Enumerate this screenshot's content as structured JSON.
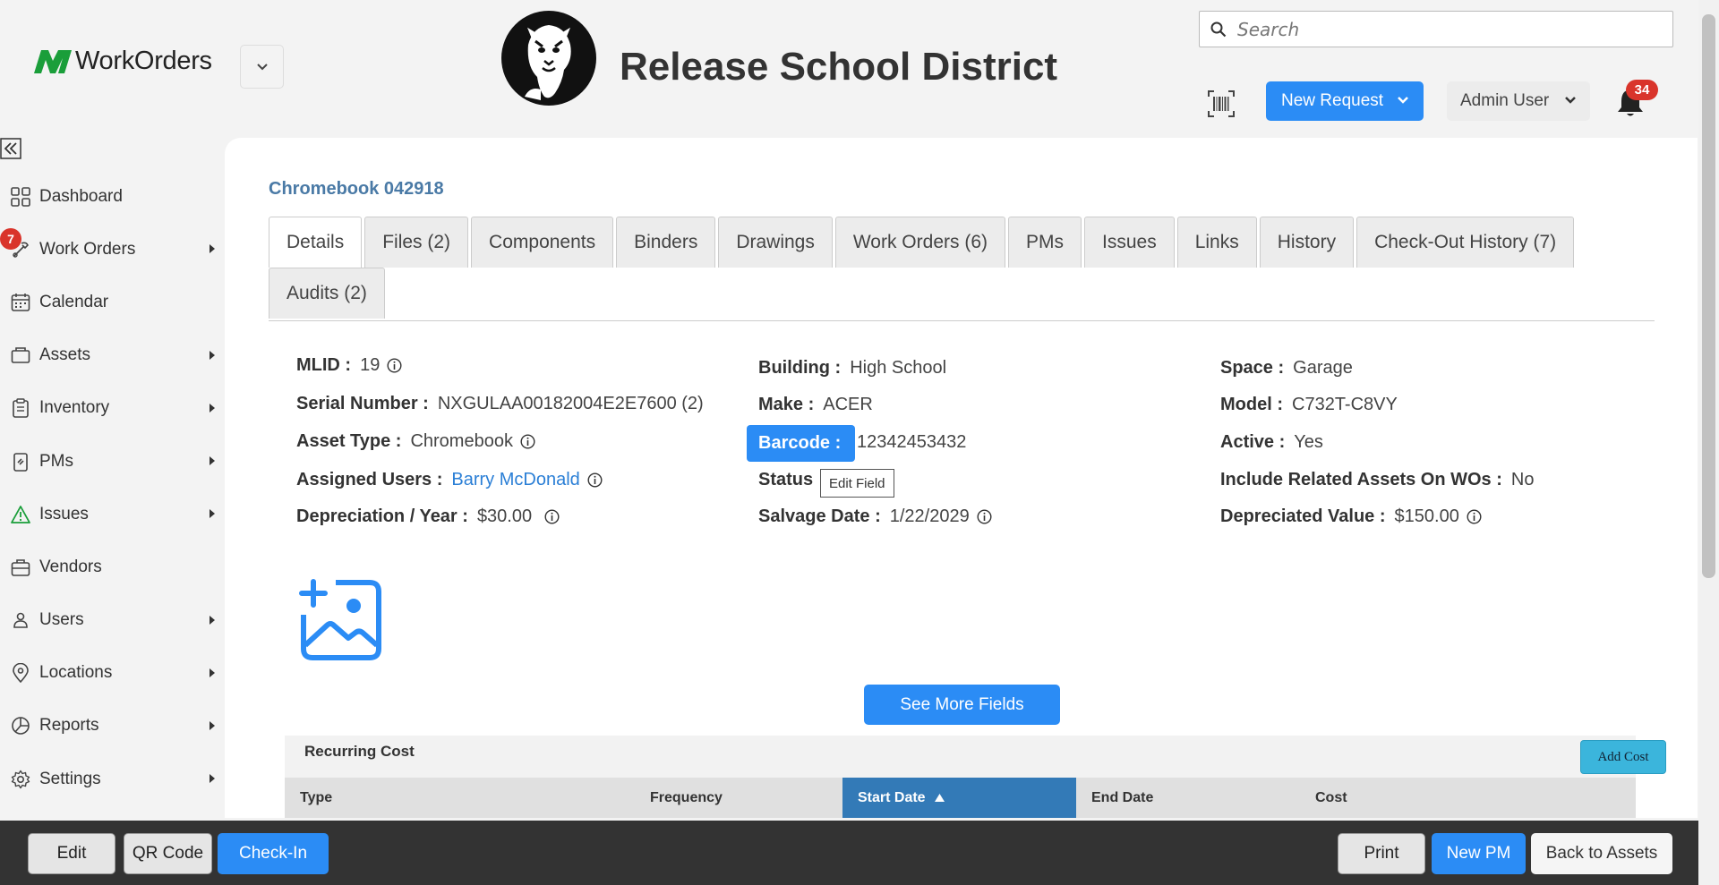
{
  "header": {
    "app_name": "WorkOrders",
    "district_name": "Release School District",
    "search_placeholder": "Search",
    "new_request_label": "New Request",
    "user_label": "Admin User",
    "notification_count": "34"
  },
  "sidebar": {
    "items": [
      {
        "label": "Dashboard",
        "icon": "dashboard-icon",
        "has_submenu": false
      },
      {
        "label": "Work Orders",
        "icon": "work-orders-icon",
        "has_submenu": true,
        "badge": "7"
      },
      {
        "label": "Calendar",
        "icon": "calendar-icon",
        "has_submenu": false
      },
      {
        "label": "Assets",
        "icon": "assets-icon",
        "has_submenu": true
      },
      {
        "label": "Inventory",
        "icon": "inventory-icon",
        "has_submenu": true
      },
      {
        "label": "PMs",
        "icon": "pms-icon",
        "has_submenu": true
      },
      {
        "label": "Issues",
        "icon": "warning-icon",
        "has_submenu": true
      },
      {
        "label": "Vendors",
        "icon": "briefcase-icon",
        "has_submenu": false
      },
      {
        "label": "Users",
        "icon": "users-icon",
        "has_submenu": true
      },
      {
        "label": "Locations",
        "icon": "location-pin-icon",
        "has_submenu": true
      },
      {
        "label": "Reports",
        "icon": "pie-chart-icon",
        "has_submenu": true
      },
      {
        "label": "Settings",
        "icon": "gear-icon",
        "has_submenu": true
      }
    ]
  },
  "asset": {
    "title": "Chromebook 042918",
    "tabs": [
      "Details",
      "Files (2)",
      "Components",
      "Binders",
      "Drawings",
      "Work Orders (6)",
      "PMs",
      "Issues",
      "Links",
      "History",
      "Check-Out History (7)",
      "Audits (2)"
    ],
    "active_tab": "Details",
    "fields": {
      "mlid_label": "MLID :",
      "mlid": "19",
      "serial_label": "Serial Number :",
      "serial": "NXGULAA00182004E2E7600 (2)",
      "asset_type_label": "Asset Type :",
      "asset_type": "Chromebook",
      "assigned_users_label": "Assigned Users :",
      "assigned_users": "Barry McDonald",
      "depreciation_label": "Depreciation / Year :",
      "depreciation": "$30.00",
      "building_label": "Building :",
      "building": "High School",
      "make_label": "Make :",
      "make": "ACER",
      "barcode_label": "Barcode :",
      "barcode": "12342453432",
      "status_label": "Status",
      "salvage_label": "Salvage Date :",
      "salvage": "1/22/2029",
      "space_label": "Space :",
      "space": "Garage",
      "model_label": "Model :",
      "model": "C732T-C8VY",
      "active_label": "Active :",
      "active": "Yes",
      "include_related_label": "Include Related Assets On WOs :",
      "include_related": "No",
      "depreciated_value_label": "Depreciated Value :",
      "depreciated_value": "$150.00"
    },
    "edit_field_tooltip": "Edit Field",
    "see_more_label": "See More Fields"
  },
  "recurring_cost": {
    "title": "Recurring Cost",
    "add_cost_label": "Add Cost",
    "columns": [
      "Type",
      "Frequency",
      "Start Date",
      "End Date",
      "Cost"
    ],
    "sorted_column": "Start Date",
    "sort_direction": "ascending"
  },
  "footer": {
    "edit": "Edit",
    "qr_code": "QR Code",
    "check_in": "Check-In",
    "print": "Print",
    "new_pm": "New PM",
    "back": "Back to Assets"
  },
  "colors": {
    "accent": "#2b8cf5",
    "title_link": "#4a7aa6",
    "badge": "#d9342b",
    "brand_green": "#1a9e3a",
    "sorted_header": "#337ab7"
  }
}
